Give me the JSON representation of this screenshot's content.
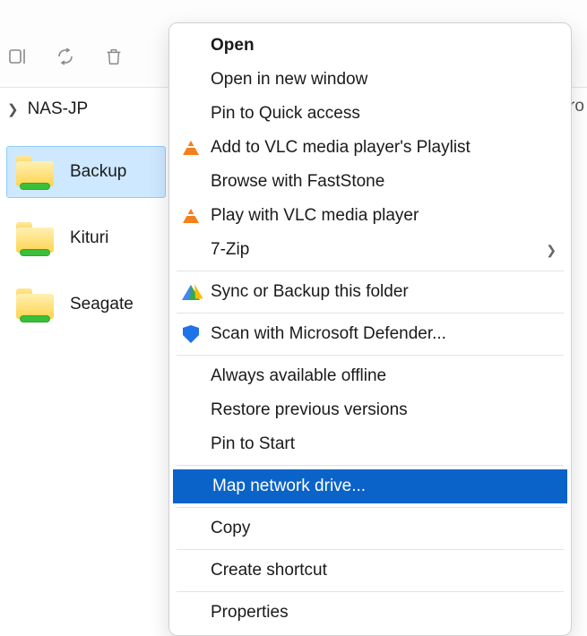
{
  "toolbar": {
    "icons": [
      "rename-icon",
      "share-icon",
      "delete-icon"
    ]
  },
  "breadcrumb": {
    "item": "NAS-JP"
  },
  "right_fragment": "ro",
  "folders": [
    {
      "name": "Backup",
      "selected": true
    },
    {
      "name": "Kituri",
      "selected": false
    },
    {
      "name": "Seagate",
      "selected": false
    }
  ],
  "context_menu": {
    "groups": [
      [
        {
          "label": "Open",
          "bold": true,
          "icon": null
        },
        {
          "label": "Open in new window",
          "icon": null
        },
        {
          "label": "Pin to Quick access",
          "icon": null
        },
        {
          "label": "Add to VLC media player's Playlist",
          "icon": "vlc-icon"
        },
        {
          "label": "Browse with FastStone",
          "icon": null
        },
        {
          "label": "Play with VLC media player",
          "icon": "vlc-icon"
        },
        {
          "label": "7-Zip",
          "icon": null,
          "submenu": true
        }
      ],
      [
        {
          "label": "Sync or Backup this folder",
          "icon": "google-drive-icon"
        }
      ],
      [
        {
          "label": "Scan with Microsoft Defender...",
          "icon": "defender-shield-icon"
        }
      ],
      [
        {
          "label": "Always available offline",
          "icon": null
        },
        {
          "label": "Restore previous versions",
          "icon": null
        },
        {
          "label": "Pin to Start",
          "icon": null
        }
      ],
      [
        {
          "label": "Map network drive...",
          "icon": null,
          "highlight": true
        }
      ],
      [
        {
          "label": "Copy",
          "icon": null
        }
      ],
      [
        {
          "label": "Create shortcut",
          "icon": null
        }
      ],
      [
        {
          "label": "Properties",
          "icon": null
        }
      ]
    ]
  }
}
